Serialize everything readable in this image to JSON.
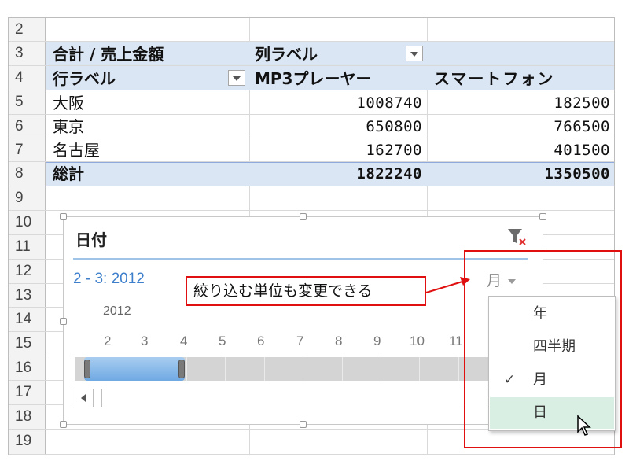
{
  "rows": [
    "2",
    "3",
    "4",
    "5",
    "6",
    "7",
    "8",
    "9",
    "10",
    "11",
    "12",
    "13",
    "14",
    "15",
    "16",
    "17",
    "18",
    "19"
  ],
  "pivot": {
    "value_header": "合計 / 売上金額",
    "column_label": "列ラベル",
    "row_label": "行ラベル",
    "col1": "MP3プレーヤー",
    "col2": "スマートフォン",
    "data": [
      {
        "name": "大阪",
        "v1": "1008740",
        "v2": "182500"
      },
      {
        "name": "東京",
        "v1": "650800",
        "v2": "766500"
      },
      {
        "name": "名古屋",
        "v1": "162700",
        "v2": "401500"
      }
    ],
    "total": {
      "name": "総計",
      "v1": "1822240",
      "v2": "1350500"
    }
  },
  "slicer": {
    "title": "日付",
    "range": "2 - 3: 2012",
    "level": "月",
    "year": "2012",
    "months": [
      "2",
      "3",
      "4",
      "5",
      "6",
      "7",
      "8",
      "9",
      "10",
      "11"
    ]
  },
  "callout": "絞り込む単位も変更できる",
  "menu": {
    "items": [
      {
        "label": "年",
        "checked": false,
        "highlighted": false
      },
      {
        "label": "四半期",
        "checked": false,
        "highlighted": false
      },
      {
        "label": "月",
        "checked": true,
        "highlighted": false
      },
      {
        "label": "日",
        "checked": false,
        "highlighted": true
      }
    ],
    "check_glyph": "✓"
  },
  "colors": {
    "accent": "#3d7fcb",
    "header_band": "#dbe6f4",
    "callout_red": "#e01010",
    "menu_highlight": "#d9efe3"
  }
}
